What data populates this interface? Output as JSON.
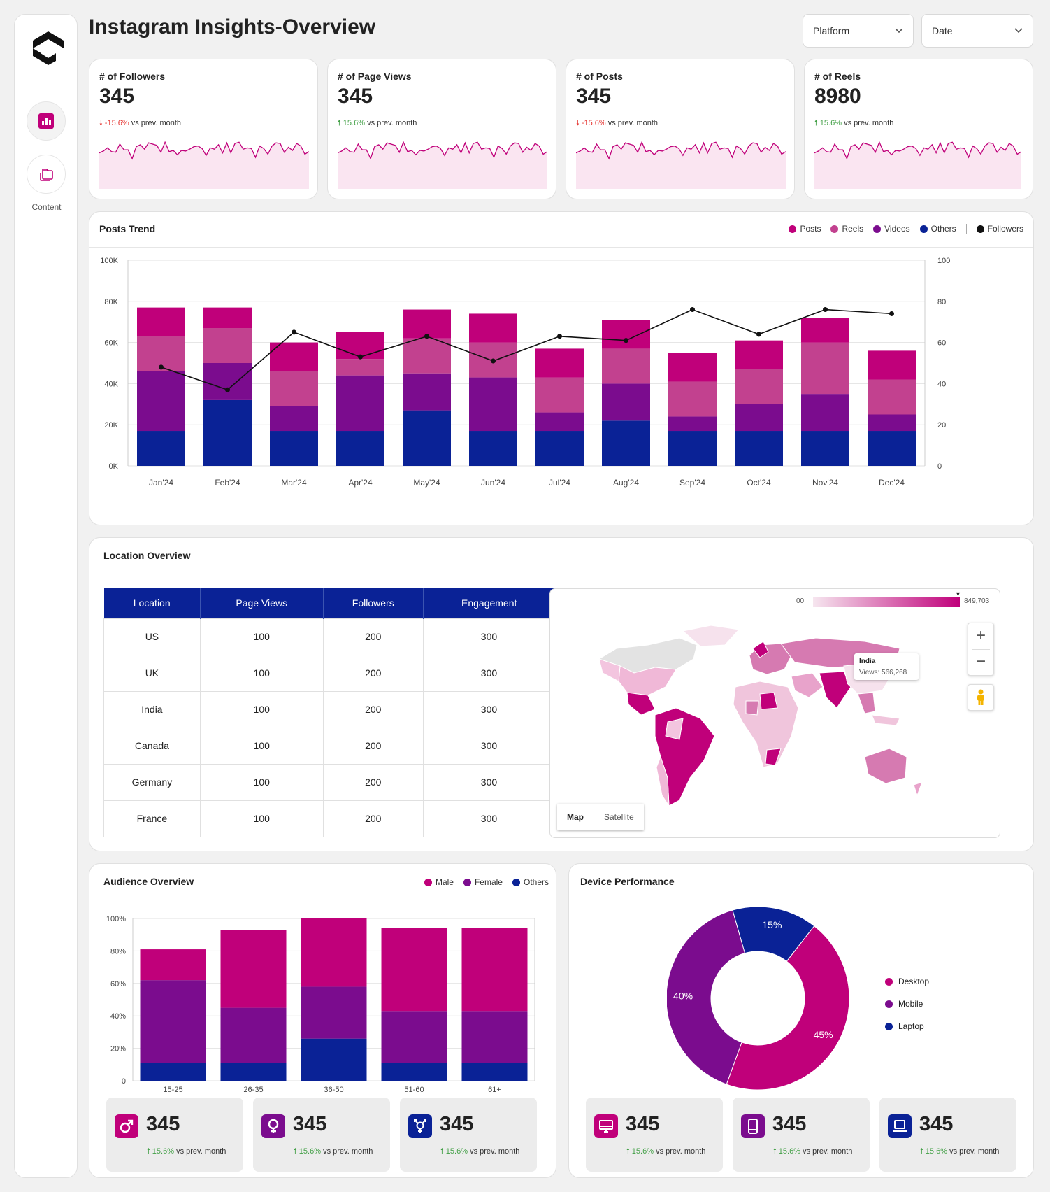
{
  "title": "Instagram Insights-Overview",
  "nav": {
    "content_label": "Content"
  },
  "filters": {
    "platform": "Platform",
    "date": "Date"
  },
  "kpis": [
    {
      "label": "# of Followers",
      "value": "345",
      "delta": "-15.6%",
      "suffix": "vs prev. month",
      "trend": "down",
      "spark": [
        36,
        39,
        44,
        38,
        37,
        50,
        41,
        41,
        27,
        46,
        49,
        42,
        52,
        50,
        48,
        37,
        53,
        38,
        40,
        33,
        40,
        39,
        42,
        46,
        47,
        43,
        32,
        44,
        42,
        49,
        36,
        52,
        36,
        51,
        53,
        42,
        44,
        43,
        29,
        47,
        43,
        34,
        47,
        52,
        51,
        37,
        45,
        40,
        51,
        47,
        34,
        38
      ]
    },
    {
      "label": "# of Page Views",
      "value": "345",
      "delta": "15.6%",
      "suffix": "vs prev. month",
      "trend": "up"
    },
    {
      "label": "# of Posts",
      "value": "345",
      "delta": "-15.6%",
      "suffix": "vs prev. month",
      "trend": "down"
    },
    {
      "label": "# of Reels",
      "value": "8980",
      "delta": "15.6%",
      "suffix": "vs prev. month",
      "trend": "up"
    }
  ],
  "posts_trend": {
    "title": "Posts Trend"
  },
  "location": {
    "title": "Location Overview",
    "columns": [
      "Location",
      "Page Views",
      "Followers",
      "Engagement"
    ],
    "rows": [
      [
        "US",
        "100",
        "200",
        "300"
      ],
      [
        "UK",
        "100",
        "200",
        "300"
      ],
      [
        "India",
        "100",
        "200",
        "300"
      ],
      [
        "Canada",
        "100",
        "200",
        "300"
      ],
      [
        "Germany",
        "100",
        "200",
        "300"
      ],
      [
        "France",
        "100",
        "200",
        "300"
      ]
    ],
    "map": {
      "scale_min": "00",
      "scale_max": "849,703",
      "tooltip_country": "India",
      "tooltip_value": "Views: 566,268",
      "map_label": "Map",
      "satellite_label": "Satellite",
      "zoom_in": "+",
      "zoom_out": "−"
    }
  },
  "audience": {
    "title": "Audience Overview",
    "stats": [
      {
        "icon": "male-icon",
        "value": "345",
        "delta": "15.6%",
        "suffix": "vs prev. month",
        "color": "#c0007a"
      },
      {
        "icon": "female-icon",
        "value": "345",
        "delta": "15.6%",
        "suffix": "vs prev. month",
        "color": "#7b0c8e"
      },
      {
        "icon": "transgender-icon",
        "value": "345",
        "delta": "15.6%",
        "suffix": "vs prev. month",
        "color": "#0a2296"
      }
    ]
  },
  "device": {
    "title": "Device Performance",
    "stats": [
      {
        "icon": "desktop-icon",
        "value": "345",
        "delta": "15.6%",
        "suffix": "vs prev. month",
        "color": "#c0007a"
      },
      {
        "icon": "mobile-icon",
        "value": "345",
        "delta": "15.6%",
        "suffix": "vs prev. month",
        "color": "#7b0c8e"
      },
      {
        "icon": "laptop-icon",
        "value": "345",
        "delta": "15.6%",
        "suffix": "vs prev. month",
        "color": "#0a2296"
      }
    ]
  },
  "colors": {
    "posts": "#c0007a",
    "reels": "#c2418f",
    "videos": "#7b0c8e",
    "others": "#0a2296",
    "followers": "#111111",
    "spark_fill": "#fae5f1"
  },
  "chart_data": [
    {
      "type": "bar",
      "stacked": true,
      "title": "Posts Trend",
      "categories": [
        "Jan'24",
        "Feb'24",
        "Mar'24",
        "Apr'24",
        "May'24",
        "Jun'24",
        "Jul'24",
        "Aug'24",
        "Sep'24",
        "Oct'24",
        "Nov'24",
        "Dec'24"
      ],
      "series": [
        {
          "name": "Others",
          "values": [
            17000,
            32000,
            17000,
            17000,
            27000,
            17000,
            17000,
            22000,
            17000,
            17000,
            17000,
            17000
          ]
        },
        {
          "name": "Videos",
          "values": [
            29000,
            18000,
            12000,
            27000,
            18000,
            26000,
            9000,
            18000,
            7000,
            13000,
            18000,
            8000
          ]
        },
        {
          "name": "Reels",
          "values": [
            17000,
            17000,
            17000,
            8000,
            17000,
            17000,
            17000,
            17000,
            17000,
            17000,
            25000,
            17000
          ]
        },
        {
          "name": "Posts",
          "values": [
            14000,
            10000,
            14000,
            13000,
            14000,
            14000,
            14000,
            14000,
            14000,
            14000,
            12000,
            14000
          ]
        },
        {
          "name": "Followers",
          "axis": "right",
          "type": "line",
          "values": [
            48,
            37,
            65,
            53,
            63,
            51,
            63,
            61,
            76,
            64,
            76,
            74
          ]
        }
      ],
      "ylim": [
        0,
        100000
      ],
      "y_ticks": [
        "0K",
        "20K",
        "40K",
        "60K",
        "80K",
        "100K"
      ],
      "y2lim": [
        0,
        100
      ],
      "y2_ticks": [
        "0",
        "20",
        "40",
        "60",
        "80",
        "100"
      ],
      "legend": [
        "Posts",
        "Reels",
        "Videos",
        "Others",
        "Followers"
      ],
      "legend_position": "top-right",
      "grid": true
    },
    {
      "type": "bar",
      "stacked": true,
      "title": "Audience Overview",
      "categories": [
        "15-25",
        "26-35",
        "36-50",
        "51-60",
        "61+"
      ],
      "series": [
        {
          "name": "Others",
          "values": [
            11,
            11,
            26,
            11,
            11
          ]
        },
        {
          "name": "Female",
          "values": [
            51,
            34,
            32,
            32,
            32
          ]
        },
        {
          "name": "Male",
          "values": [
            19,
            48,
            42,
            51,
            51
          ]
        }
      ],
      "ylim": [
        0,
        100
      ],
      "y_ticks": [
        "0",
        "20%",
        "40%",
        "60%",
        "80%",
        "100%"
      ],
      "legend": [
        "Male",
        "Female",
        "Others"
      ],
      "legend_position": "top-right",
      "grid": true
    },
    {
      "type": "pie",
      "donut": true,
      "title": "Device Performance",
      "labels": [
        "Desktop",
        "Mobile",
        "Laptop"
      ],
      "values": [
        45,
        40,
        15
      ],
      "value_labels": [
        "45%",
        "40%",
        "15%"
      ],
      "legend_position": "right"
    }
  ]
}
